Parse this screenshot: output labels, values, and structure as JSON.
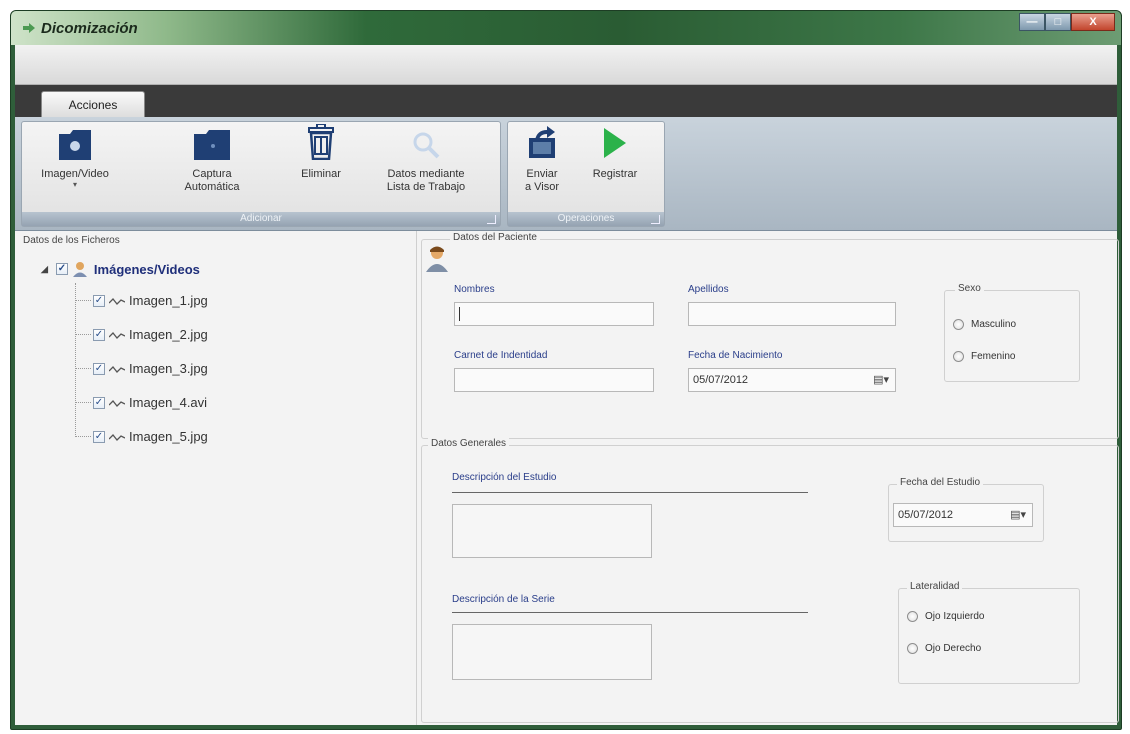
{
  "window": {
    "title": "Dicomización",
    "minimize": "—",
    "maximize": "□",
    "close": "X"
  },
  "ribbon": {
    "tab": "Acciones",
    "groups": {
      "adicionar": {
        "label": "Adicionar"
      },
      "operaciones": {
        "label": "Operaciones"
      }
    },
    "buttons": {
      "imagen_video": "Imagen/Video",
      "captura_line1": "Captura",
      "captura_line2": "Automática",
      "eliminar": "Eliminar",
      "datos_line1": "Datos mediante",
      "datos_line2": "Lista de Trabajo",
      "enviar_line1": "Enviar",
      "enviar_line2": "a Visor",
      "registrar": "Registrar"
    },
    "colors": {
      "folder": "#1f3f74",
      "play": "#2bb24a"
    }
  },
  "files": {
    "title": "Datos de los Ficheros",
    "root": "Imágenes/Videos",
    "items": [
      "Imagen_1.jpg",
      "Imagen_2.jpg",
      "Imagen_3.jpg",
      "Imagen_4.avi",
      "Imagen_5.jpg"
    ]
  },
  "patient": {
    "title": "Datos del Paciente",
    "nombres_label": "Nombres",
    "apellidos_label": "Apellidos",
    "carnet_label": "Carnet de Indentidad",
    "fecha_nac_label": "Fecha de Nacimiento",
    "fecha_nac_value": "05/07/2012",
    "sexo": {
      "title": "Sexo",
      "options": [
        "Masculino",
        "Femenino"
      ]
    }
  },
  "general": {
    "title": "Datos Generales",
    "desc_estudio_label": "Descripción del Estudio",
    "fecha_estudio_title": "Fecha del Estudio",
    "fecha_estudio_value": "05/07/2012",
    "desc_serie_label": "Descripción de la Serie",
    "lateralidad": {
      "title": "Lateralidad",
      "options": [
        "Ojo Izquierdo",
        "Ojo Derecho"
      ]
    }
  }
}
